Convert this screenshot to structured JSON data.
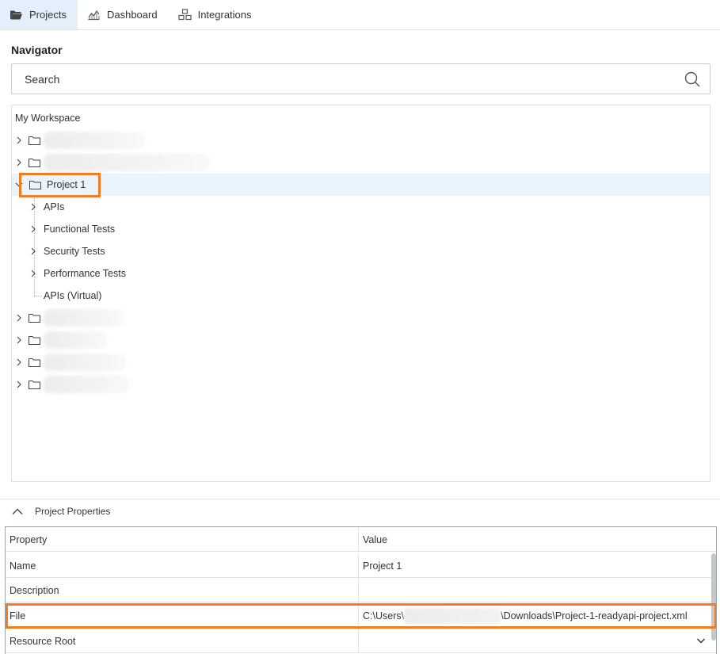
{
  "tabs": [
    {
      "label": "Projects",
      "icon": "folder-open-icon",
      "active": true
    },
    {
      "label": "Dashboard",
      "icon": "chart-icon",
      "active": false
    },
    {
      "label": "Integrations",
      "icon": "integrations-icon",
      "active": false
    }
  ],
  "navigator": {
    "title": "Navigator",
    "search_placeholder": "Search",
    "root_label": "My Workspace",
    "project_label": "Project 1",
    "children": [
      "APIs",
      "Functional Tests",
      "Security Tests",
      "Performance Tests",
      "APIs (Virtual)"
    ]
  },
  "properties": {
    "title": "Project Properties",
    "col_property": "Property",
    "col_value": "Value",
    "rows": [
      {
        "key": "Name",
        "value": "Project 1"
      },
      {
        "key": "Description",
        "value": ""
      },
      {
        "key": "File",
        "value_prefix": "C:\\Users\\",
        "value_suffix": "\\Downloads\\Project-1-readyapi-project.xml"
      },
      {
        "key": "Resource Root",
        "value": ""
      }
    ]
  },
  "colors": {
    "highlight": "#f47b20",
    "active_tab": "#e3f0fb",
    "selected_row": "#e9f4fc"
  }
}
